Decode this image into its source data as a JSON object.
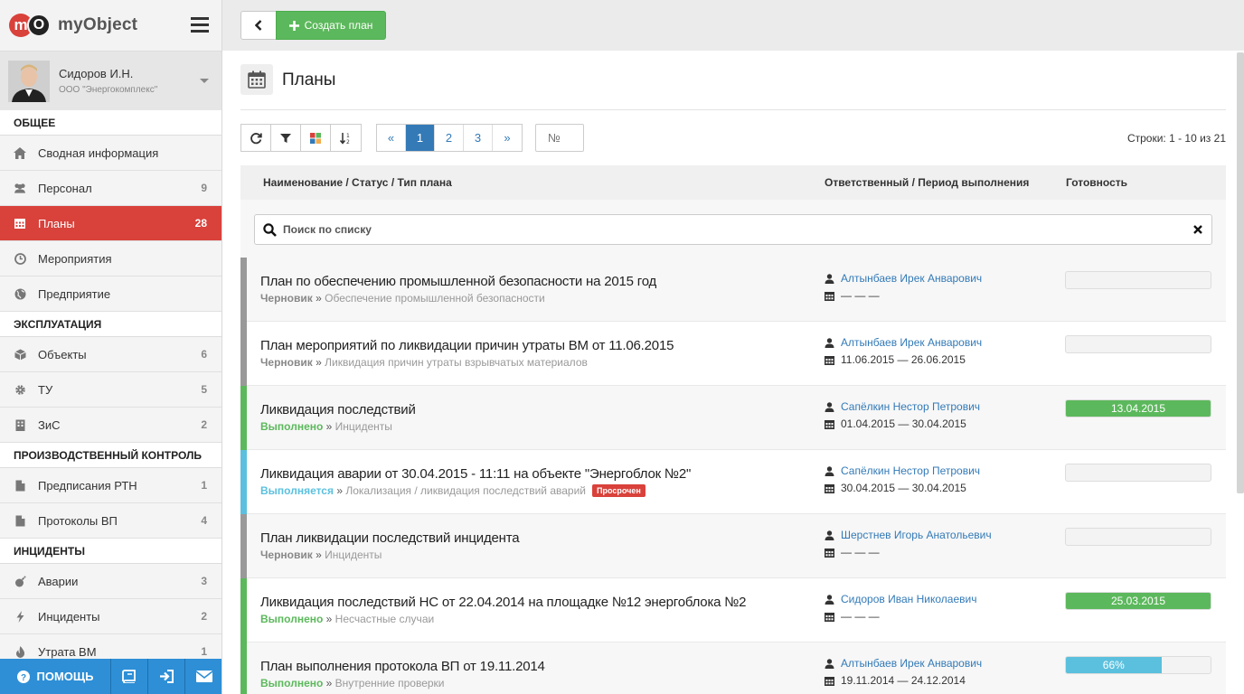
{
  "brand": {
    "logo_m": "m",
    "logo_o": "O",
    "name": "myObject"
  },
  "user": {
    "name": "Сидоров И.Н.",
    "org": "ООО \"Энергокомплекс\""
  },
  "sidebar": {
    "sections": [
      {
        "title": "ОБЩЕЕ",
        "items": [
          {
            "label": "Сводная информация",
            "count": "",
            "icon": "home-icon",
            "active": false
          },
          {
            "label": "Персонал",
            "count": "9",
            "icon": "users-icon",
            "active": false
          },
          {
            "label": "Планы",
            "count": "28",
            "icon": "calendar-icon",
            "active": true
          },
          {
            "label": "Мероприятия",
            "count": "",
            "icon": "clock-icon",
            "active": false
          },
          {
            "label": "Предприятие",
            "count": "",
            "icon": "globe-icon",
            "active": false
          }
        ]
      },
      {
        "title": "ЭКСПЛУАТАЦИЯ",
        "items": [
          {
            "label": "Объекты",
            "count": "6",
            "icon": "cube-icon",
            "active": false
          },
          {
            "label": "ТУ",
            "count": "5",
            "icon": "gear-icon",
            "active": false
          },
          {
            "label": "ЗиС",
            "count": "2",
            "icon": "building-icon",
            "active": false
          }
        ]
      },
      {
        "title": "ПРОИЗВОДСТВЕННЫЙ КОНТРОЛЬ",
        "items": [
          {
            "label": "Предписания РТН",
            "count": "1",
            "icon": "file-icon",
            "active": false
          },
          {
            "label": "Протоколы ВП",
            "count": "4",
            "icon": "file-icon",
            "active": false
          }
        ]
      },
      {
        "title": "ИНЦИДЕНТЫ",
        "items": [
          {
            "label": "Аварии",
            "count": "3",
            "icon": "bomb-icon",
            "active": false
          },
          {
            "label": "Инциденты",
            "count": "2",
            "icon": "bolt-icon",
            "active": false
          },
          {
            "label": "Утрата ВМ",
            "count": "1",
            "icon": "fire-icon",
            "active": false
          }
        ]
      }
    ]
  },
  "bottom_bar": {
    "help_label": "ПОМОЩЬ"
  },
  "topbar": {
    "create_label": "Создать план"
  },
  "page": {
    "title": "Планы"
  },
  "pager": {
    "pages": [
      "«",
      "1",
      "2",
      "3",
      "»"
    ],
    "active": "1"
  },
  "number_filter": {
    "placeholder": "№"
  },
  "rows_info": "Строки: 1 - 10 из 21",
  "table": {
    "headers": {
      "name": "Наименование / Статус / Тип плана",
      "resp": "Ответственный / Период выполнения",
      "ready": "Готовность"
    },
    "search_placeholder": "Поиск по списку",
    "rows": [
      {
        "title": "План по обеспечению промышленной безопасности на 2015 год",
        "status": "Черновик",
        "status_color": "#888888",
        "bar_color": "#999999",
        "type": "Обеспечение промышленной безопасности",
        "badge": "",
        "responsible": "Алтынбаев Ирек Анварович",
        "period": "— — —",
        "progress": 0,
        "progress_label": "",
        "progress_color": ""
      },
      {
        "title": "План мероприятий по ликвидации причин утраты ВМ от 11.06.2015",
        "status": "Черновик",
        "status_color": "#888888",
        "bar_color": "#999999",
        "type": "Ликвидация причин утраты взрывчатых материалов",
        "badge": "",
        "responsible": "Алтынбаев Ирек Анварович",
        "period": "11.06.2015 — 26.06.2015",
        "progress": 0,
        "progress_label": "",
        "progress_color": ""
      },
      {
        "title": "Ликвидация последствий",
        "status": "Выполнено",
        "status_color": "#5cb85c",
        "bar_color": "#5cb85c",
        "type": "Инциденты",
        "badge": "",
        "responsible": "Сапёлкин Нестор Петрович",
        "period": "01.04.2015 — 30.04.2015",
        "progress": 100,
        "progress_label": "13.04.2015",
        "progress_color": "#5cb85c"
      },
      {
        "title": "Ликвидация аварии от 30.04.2015 - 11:11 на объекте \"Энергоблок №2\"",
        "status": "Выполняется",
        "status_color": "#5bc0de",
        "bar_color": "#5bc0de",
        "type": "Локализация / ликвидация последствий аварий",
        "badge": "Просрочен",
        "responsible": "Сапёлкин Нестор Петрович",
        "period": "30.04.2015 — 30.04.2015",
        "progress": 0,
        "progress_label": "",
        "progress_color": ""
      },
      {
        "title": "План ликвидации последствий инцидента",
        "status": "Черновик",
        "status_color": "#888888",
        "bar_color": "#999999",
        "type": "Инциденты",
        "badge": "",
        "responsible": "Шерстнев Игорь Анатольевич",
        "period": "— — —",
        "progress": 0,
        "progress_label": "",
        "progress_color": ""
      },
      {
        "title": "Ликвидация последствий НС от 22.04.2014 на площадке №12 энергоблока №2",
        "status": "Выполнено",
        "status_color": "#5cb85c",
        "bar_color": "#5cb85c",
        "type": "Несчастные случаи",
        "badge": "",
        "responsible": "Сидоров Иван Николаевич",
        "period": "— — —",
        "progress": 100,
        "progress_label": "25.03.2015",
        "progress_color": "#5cb85c"
      },
      {
        "title": "План выполнения протокола ВП от 19.11.2014",
        "status": "Выполнено",
        "status_color": "#5cb85c",
        "bar_color": "#5cb85c",
        "type": "Внутренние проверки",
        "badge": "",
        "responsible": "Алтынбаев Ирек Анварович",
        "period": "19.11.2014 — 24.12.2014",
        "progress": 66,
        "progress_label": "66%",
        "progress_color": "#5bc0de"
      }
    ]
  },
  "colors": {
    "accent_red": "#d9413b",
    "green": "#5cb85c",
    "blue": "#337ab7",
    "info": "#5bc0de",
    "help_bar": "#2e8fd6"
  }
}
